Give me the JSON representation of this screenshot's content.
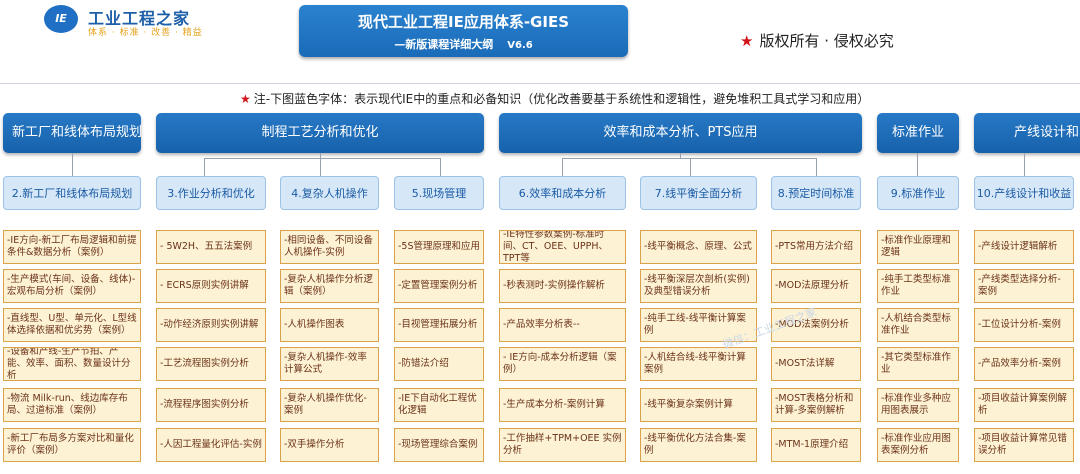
{
  "logo": {
    "mark": "IE",
    "name": "工业工程之家",
    "tagline": "体系 · 标准 · 改善 · 精益"
  },
  "title": {
    "main": "现代工业工程IE应用体系-GIES",
    "sub": "—新版课程详细大纲",
    "version": "V6.6"
  },
  "copyright": {
    "star": "★",
    "text": "版权所有 · 侵权必究"
  },
  "note": {
    "star": "★",
    "text": "注-下图蓝色字体：表示现代IE中的重点和必备知识（优化改善要基于系统性和逻辑性，避免堆积工具式学习和应用）"
  },
  "categories": [
    "新工厂和线体布局规划",
    "制程工艺分析和优化",
    "效率和成本分析、PTS应用",
    "标准作业",
    "产线设计和收益"
  ],
  "modules": [
    {
      "title": "2.新工厂和线体布局规划",
      "items": [
        "-IE方向-新工厂布局逻辑和前提条件&数据分析（案例）",
        "-生产模式(车间、设备、线体)-宏观布局分析（案例）",
        "-直线型、U型、单元化、L型线体选择依据和优劣势（案例）",
        "-设备和产线-生产节拍、产能、效率、面积、数量设计分析",
        "-物流 Milk-run、线边库存布局、过道标准（案例）",
        "-新工厂布局多方案对比和量化评价（案例）"
      ]
    },
    {
      "title": "3.作业分析和优化",
      "items": [
        "- 5W2H、五五法案例",
        "- ECRS原则实例讲解",
        "-动作经济原则实例讲解",
        "-工艺流程图实例分析",
        "-流程程序图实例分析",
        "-人因工程量化评估-实例"
      ]
    },
    {
      "title": "4.复杂人机操作",
      "items": [
        "-相同设备、不同设备人机操作-实例",
        "-复杂人机操作分析逻辑（案例）",
        "-人机操作图表",
        "-复杂人机操作-效率计算公式",
        "-复杂人机操作优化-案例",
        "-双手操作分析"
      ]
    },
    {
      "title": "5.现场管理",
      "items": [
        "-5S管理原理和应用",
        "-定置管理案例分析",
        "-目视管理拓展分析",
        "-防错法介绍",
        "-IE下自动化工程优化逻辑",
        "-现场管理综合案例"
      ]
    },
    {
      "title": "6.效率和成本分析",
      "items": [
        "-IE特性参数案例-标准时间、CT、OEE、UPPH、TPT等",
        "-秒表测时-实例操作解析",
        "-产品效率分析表--",
        "- IE方向-成本分析逻辑（案例）",
        "-生产成本分析-案例计算",
        "-工作抽样+TPM+OEE 实例分析"
      ]
    },
    {
      "title": "7.线平衡全面分析",
      "items": [
        "-线平衡概念、原理、公式",
        "-线平衡深层次剖析(实例)及典型错误分析",
        "-纯手工线-线平衡计算案例",
        "-人机结合线-线平衡计算案例",
        "-线平衡复杂案例计算",
        "-线平衡优化方法合集-案例"
      ]
    },
    {
      "title": "8.预定时间标准",
      "items": [
        "-PTS常用方法介绍",
        "-MOD法原理分析",
        "-MOD法案例分析",
        "-MOST法详解",
        "-MOST表格分析和计算-多案例解析",
        "-MTM-1原理介绍"
      ]
    },
    {
      "title": "9.标准作业",
      "items": [
        "-标准作业原理和逻辑",
        "-纯手工类型标准作业",
        "-人机结合类型标准作业",
        "-其它类型标准作业",
        "-标准作业多种应用图表展示",
        "-标准作业应用图表案例分析"
      ]
    },
    {
      "title": "10.产线设计和收益",
      "items": [
        "-产线设计逻辑解析",
        "-产线类型选择分析-案例",
        "-工位设计分析-案例",
        "-产品效率分析-案例",
        "-项目收益计算案例解析",
        "-项目收益计算常见错误分析"
      ]
    }
  ],
  "watermark": "微信：工业工程之家"
}
